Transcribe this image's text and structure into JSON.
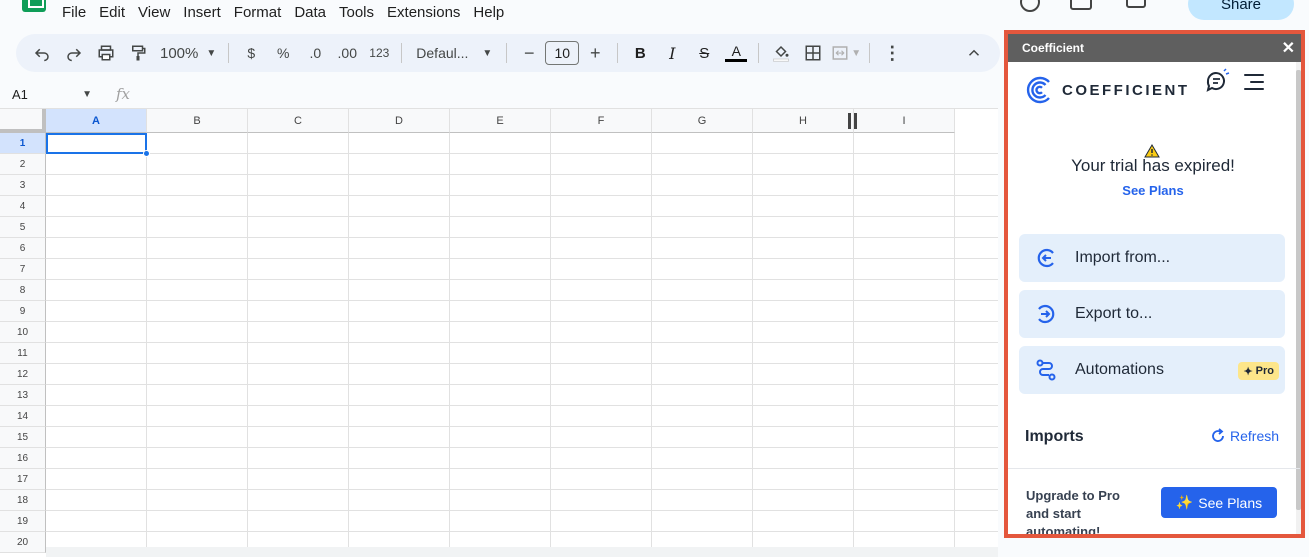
{
  "menu": [
    "File",
    "Edit",
    "View",
    "Insert",
    "Format",
    "Data",
    "Tools",
    "Extensions",
    "Help"
  ],
  "share_label": "Share",
  "toolbar": {
    "zoom": "100%",
    "currency": "$",
    "percent": "%",
    "decrease_decimal": ".0",
    "increase_decimal": ".00",
    "number_format": "123",
    "font": "Defaul...",
    "font_size": "10",
    "bold": "B",
    "italic": "I",
    "strike": "S",
    "text_color": "A"
  },
  "formula_bar": {
    "cell_ref": "A1",
    "fx": "fx"
  },
  "grid": {
    "columns": [
      "A",
      "B",
      "C",
      "D",
      "E",
      "F",
      "G",
      "H",
      "I"
    ],
    "rows": [
      "1",
      "2",
      "3",
      "4",
      "5",
      "6",
      "7",
      "8",
      "9",
      "10",
      "11",
      "12",
      "13",
      "14",
      "15",
      "16",
      "17",
      "18",
      "19",
      "20"
    ],
    "selected_cell": "A1"
  },
  "panel": {
    "title": "Coefficient",
    "close": "✕",
    "brand": "COEFFICIENT",
    "trial_message": "Your trial has expired!",
    "see_plans_link": "See Plans",
    "actions": [
      {
        "label": "Import from..."
      },
      {
        "label": "Export to..."
      },
      {
        "label": "Automations",
        "badge": "Pro"
      }
    ],
    "imports_title": "Imports",
    "refresh_label": "Refresh",
    "upgrade_text": "Upgrade to Pro and start automating!",
    "see_plans_button": "See Plans"
  },
  "colors": {
    "panel_border": "#e4573d",
    "accent_blue": "#2563eb",
    "card_bg": "#e4effb",
    "pro_badge": "#fde68a",
    "selection": "#1a73e8"
  }
}
